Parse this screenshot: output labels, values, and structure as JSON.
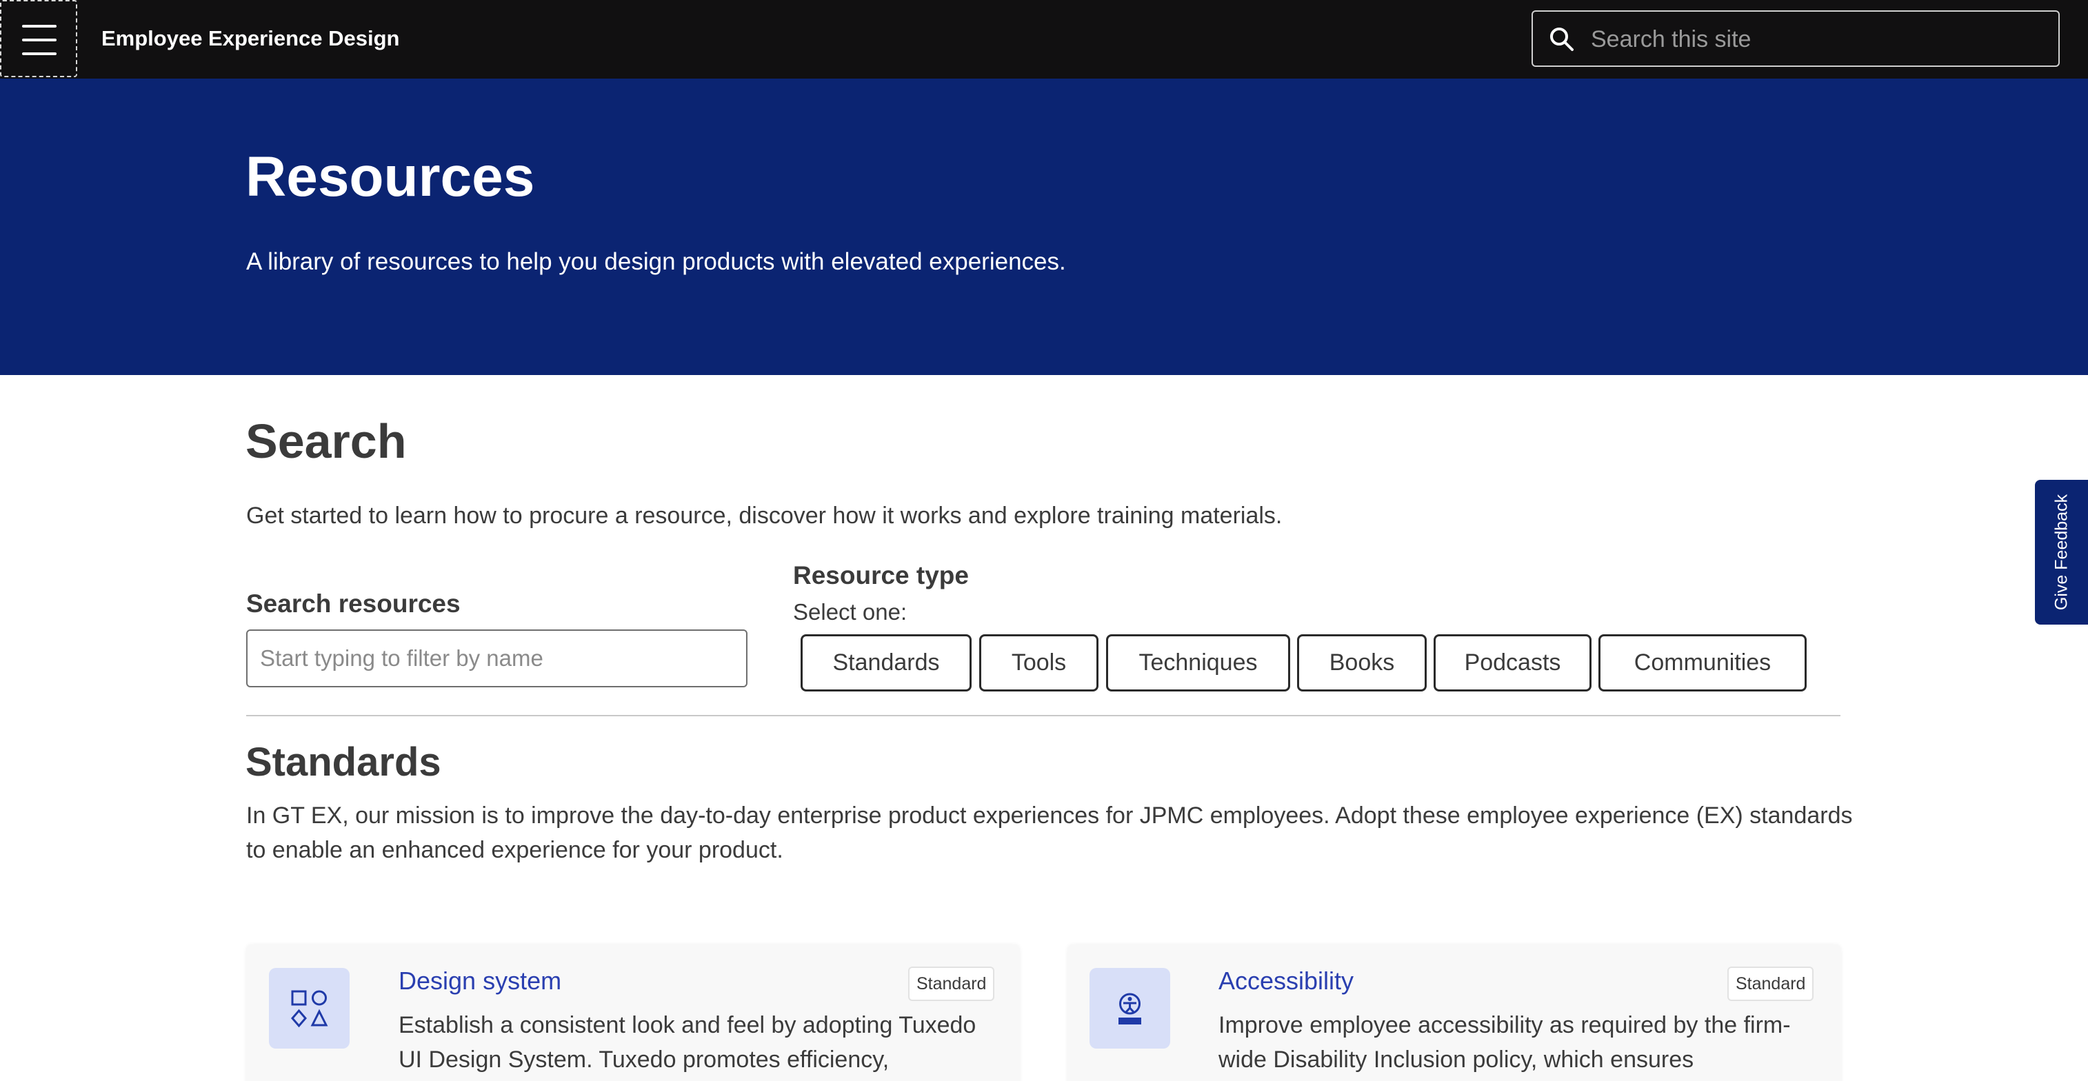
{
  "header": {
    "menu_icon": "hamburger-menu-icon",
    "site_title": "Employee Experience Design",
    "search_placeholder": "Search this site",
    "search_icon": "search-icon"
  },
  "hero": {
    "title": "Resources",
    "subtitle": "A library of resources to help you design products with elevated experiences."
  },
  "search_section": {
    "title": "Search",
    "description": "Get started to learn how to procure a resource, discover how it works and explore training materials.",
    "filter_label": "Search resources",
    "filter_placeholder": "Start typing to filter by name",
    "type_label": "Resource type",
    "type_hint": "Select one:",
    "types": [
      "Standards",
      "Tools",
      "Techniques",
      "Books",
      "Podcasts",
      "Communities"
    ]
  },
  "standards": {
    "title": "Standards",
    "description": "In GT EX, our mission is to improve the day-to-day enterprise product experiences for JPMC employees. Adopt these employee experience (EX) standards to enable an enhanced experience for your product.",
    "cards": [
      {
        "title": "Design system",
        "badge": "Standard",
        "icon": "shapes-icon",
        "text": "Establish a consistent look and feel by adopting Tuxedo UI Design System. Tuxedo promotes efficiency,"
      },
      {
        "title": "Accessibility",
        "badge": "Standard",
        "icon": "accessibility-icon",
        "text": "Improve employee accessibility as required by the firm-wide Disability Inclusion policy, which ensures"
      }
    ]
  },
  "feedback": {
    "label": "Give Feedback"
  },
  "colors": {
    "topbar": "#111011",
    "hero": "#0b2472",
    "link": "#2a3fb0",
    "icon_bg": "#d8dff8"
  }
}
